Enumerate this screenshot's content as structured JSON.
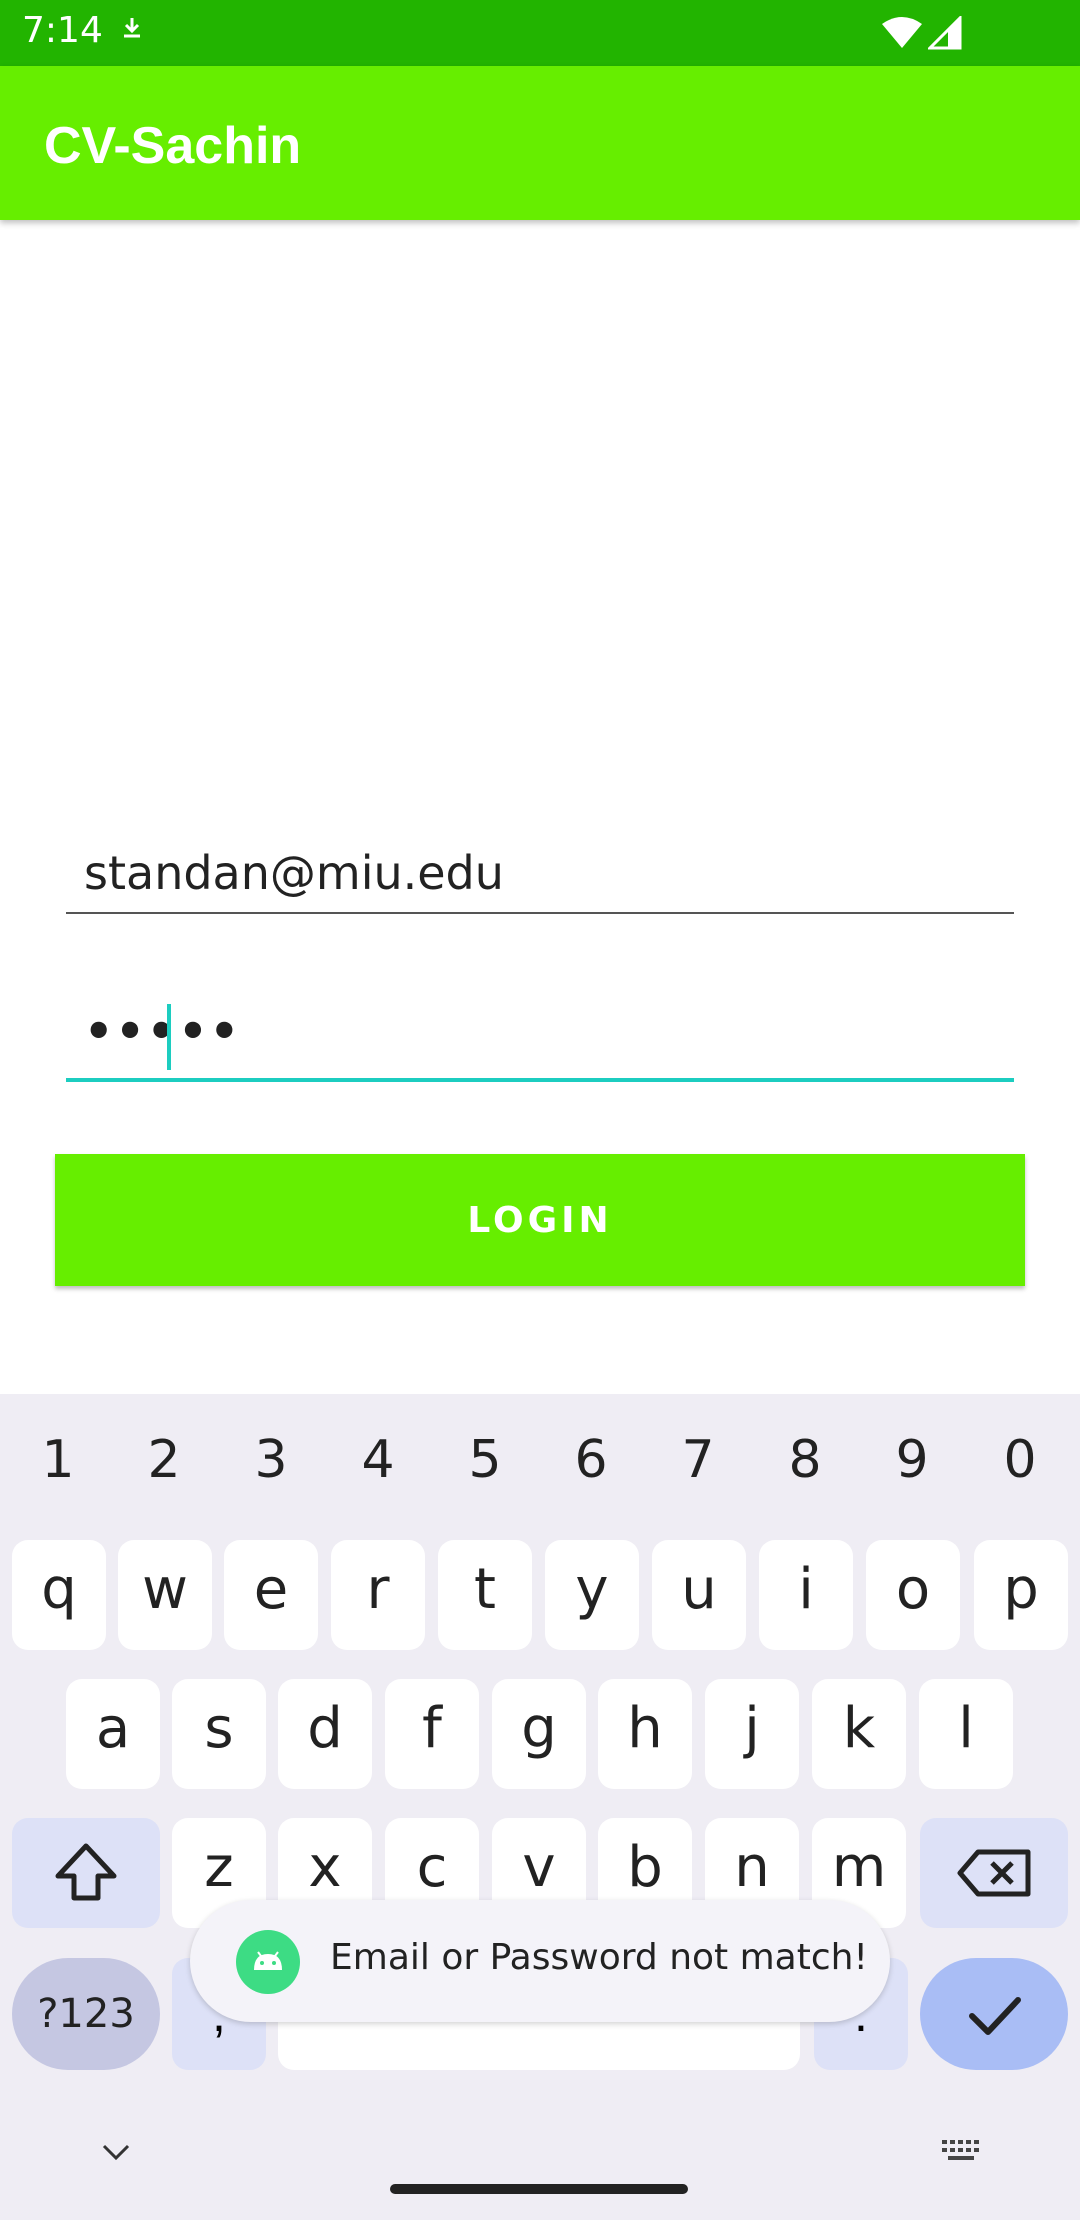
{
  "status_bar": {
    "time": "7:14",
    "download_icon": "download-icon",
    "wifi_icon": "wifi-icon",
    "signal_icon": "signal-icon"
  },
  "app_bar": {
    "title": "CV-Sachin"
  },
  "form": {
    "email_value": "standan@miu.edu",
    "password_mask": "•••••",
    "login_label": "LOGIN"
  },
  "colors": {
    "status_bar": "#22b400",
    "app_bar": "#66ee00",
    "accent": "#1ccdc0",
    "button": "#66ee00"
  },
  "keyboard": {
    "digits": [
      "1",
      "2",
      "3",
      "4",
      "5",
      "6",
      "7",
      "8",
      "9",
      "0"
    ],
    "row1": [
      "q",
      "w",
      "e",
      "r",
      "t",
      "y",
      "u",
      "i",
      "o",
      "p"
    ],
    "row2": [
      "a",
      "s",
      "d",
      "f",
      "g",
      "h",
      "j",
      "k",
      "l"
    ],
    "row3": [
      "z",
      "x",
      "c",
      "v",
      "b",
      "n",
      "m"
    ],
    "symbols_label": "?123",
    "comma": ",",
    "period": "."
  },
  "toast": {
    "message": "Email or Password not match!",
    "icon": "android-icon"
  }
}
